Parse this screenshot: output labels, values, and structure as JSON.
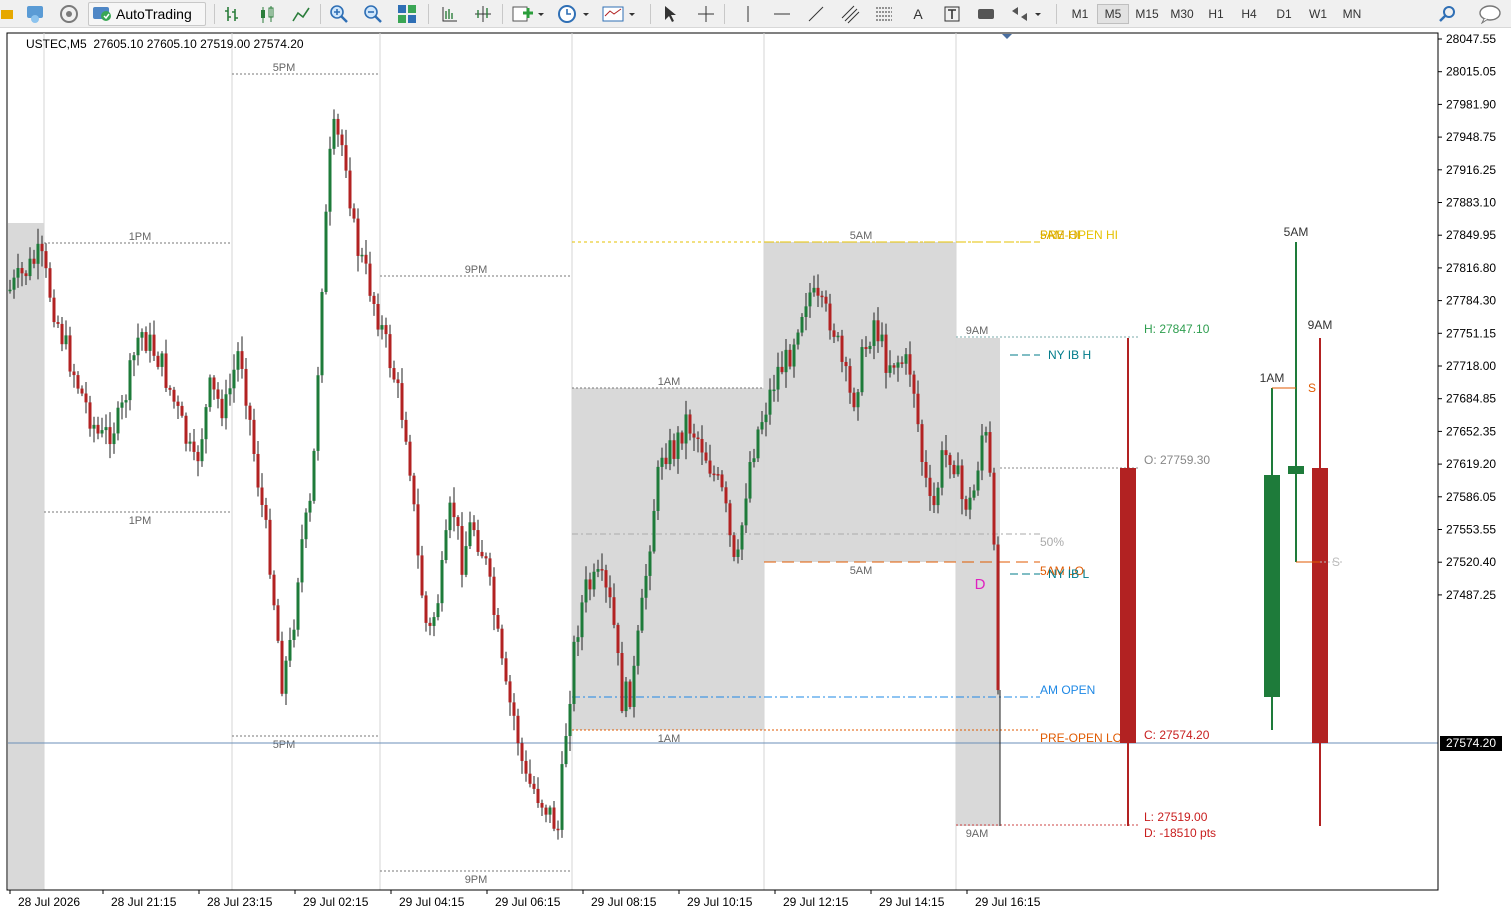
{
  "toolbar": {
    "autotrading_label": "AutoTrading",
    "timeframes": [
      "M1",
      "M5",
      "M15",
      "M30",
      "H1",
      "H4",
      "D1",
      "W1",
      "MN"
    ],
    "text_tool_label": "A"
  },
  "chart": {
    "symbol_info": "USTEC,M5  27605.10 27605.10 27519.00 27574.20",
    "current_price": "27574.20",
    "price_axis_labels": [
      "28047.55",
      "28015.05",
      "27981.90",
      "27948.75",
      "27916.25",
      "27883.10",
      "27849.95",
      "27816.80",
      "27784.30",
      "27751.15",
      "27718.00",
      "27684.85",
      "27652.35",
      "27619.20",
      "27586.05",
      "27553.55",
      "27520.40",
      "27487.25"
    ],
    "time_axis_labels": [
      "28 Jul 2026",
      "28 Jul 21:15",
      "28 Jul 23:15",
      "29 Jul 02:15",
      "29 Jul 04:15",
      "29 Jul 06:15",
      "29 Jul 08:15",
      "29 Jul 10:15",
      "29 Jul 12:15",
      "29 Jul 14:15",
      "29 Jul 16:15"
    ],
    "session_labels": {
      "a": "1PM",
      "b": "1PM",
      "c": "5PM",
      "d": "5PM",
      "e": "9PM",
      "f": "9PM",
      "g": "1AM",
      "h": "1AM",
      "i": "5AM",
      "j": "5AM",
      "k": "9AM",
      "l": "9AM"
    },
    "levels": {
      "pre_open_hi": "PRE-OPEN HI",
      "five_am_hi": "5AM HI",
      "ny_ib_h": "NY IB H",
      "fifty": "50%",
      "five_am_lo": "5AM LO",
      "ny_ib_l": "NY IB L",
      "am_open": "AM OPEN",
      "pre_open_lo": "PRE-OPEN LO",
      "marker_d": "D"
    },
    "htf_stats": {
      "high": "H: 27847.10",
      "open": "O: 27759.30",
      "close": "C: 27574.20",
      "low": "L: 27519.00",
      "range": "D: -18510 pts"
    },
    "htf_candles": {
      "label_1am": "1AM",
      "label_5am": "5AM",
      "label_9am": "9AM",
      "s_label_1": "S",
      "s_label_2": "S"
    },
    "colors": {
      "bull": "#1e7b3a",
      "bear": "#b22222",
      "session_box": "#d9d9d9",
      "pre_open": "#e6c200",
      "five_am": "#e05a00",
      "ny_ib": "#007b8a",
      "am_open": "#1e88e5",
      "high_text": "#2e9e4f",
      "low_text": "#c81e1e"
    }
  }
}
